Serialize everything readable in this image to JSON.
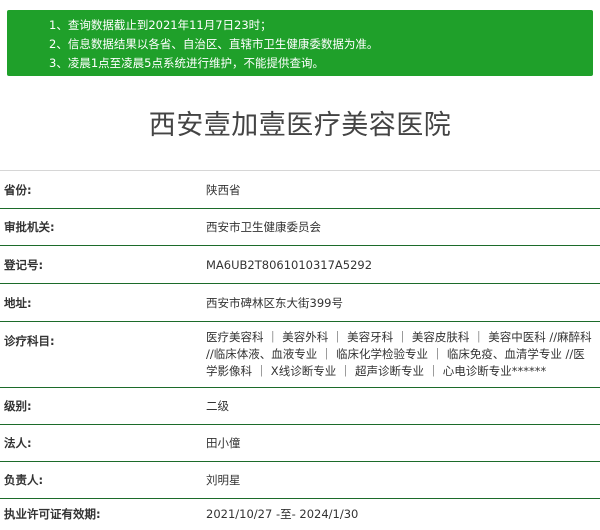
{
  "notice": {
    "lines": [
      "1、查询数据截止到2021年11月7日23时；",
      "2、信息数据结果以各省、自治区、直辖市卫生健康委数据为准。",
      "3、凌晨1点至凌晨5点系统进行维护，不能提供查询。"
    ]
  },
  "hospital": {
    "name": "西安壹加壹医疗美容医院"
  },
  "info": [
    {
      "label": "省份:",
      "value": "陕西省"
    },
    {
      "label": "审批机关:",
      "value": "西安市卫生健康委员会"
    },
    {
      "label": "登记号:",
      "value": "MA6UB2T8061010317A5292"
    },
    {
      "label": "地址:",
      "value": "西安市碑林区东大街399号"
    },
    {
      "label": "诊疗科目:",
      "value": "医疗美容科 ｜ 美容外科 ｜ 美容牙科 ｜ 美容皮肤科 ｜ 美容中医科 //麻醉科 //临床体液、血液专业 ｜ 临床化学检验专业 ｜ 临床免疫、血清学专业 //医学影像科 ｜ X线诊断专业 ｜ 超声诊断专业 ｜ 心电诊断专业******"
    },
    {
      "label": "级别:",
      "value": "二级"
    },
    {
      "label": "法人:",
      "value": "田小僮"
    },
    {
      "label": "负责人:",
      "value": "刘明星"
    },
    {
      "label": "执业许可证有效期:",
      "value": "2021/10/27 -至- 2024/1/30"
    }
  ]
}
